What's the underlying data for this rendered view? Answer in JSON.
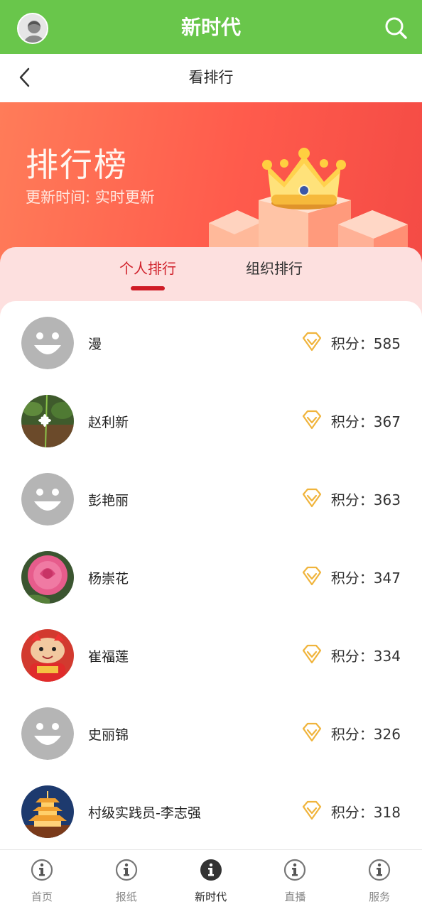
{
  "appbar": {
    "title": "新时代",
    "avatar_icon": "user-avatar-icon",
    "search_icon": "search-icon"
  },
  "subheader": {
    "title": "看排行",
    "back_icon": "chevron-left-icon"
  },
  "banner": {
    "title": "排行榜",
    "subtitle": "更新时间: 实时更新",
    "art_icon": "crown-icon"
  },
  "tabs": [
    {
      "label": "个人排行",
      "active": true
    },
    {
      "label": "组织排行",
      "active": false
    }
  ],
  "rankings": [
    {
      "name": "漫",
      "score_label": "积分：585",
      "avatar": "default-smiley"
    },
    {
      "name": "赵利新",
      "score_label": "积分：367",
      "avatar": "photo-plant"
    },
    {
      "name": "彭艳丽",
      "score_label": "积分：363",
      "avatar": "default-smiley"
    },
    {
      "name": "杨崇花",
      "score_label": "积分：347",
      "avatar": "photo-rose"
    },
    {
      "name": "崔福莲",
      "score_label": "积分：334",
      "avatar": "photo-red-toy"
    },
    {
      "name": "史丽锦",
      "score_label": "积分：326",
      "avatar": "default-smiley"
    },
    {
      "name": "村级实践员-李志强",
      "score_label": "积分：318",
      "avatar": "photo-pagoda"
    }
  ],
  "bottom_nav": [
    {
      "label": "首页",
      "active": false
    },
    {
      "label": "报纸",
      "active": false
    },
    {
      "label": "新时代",
      "active": true
    },
    {
      "label": "直播",
      "active": false
    },
    {
      "label": "服务",
      "active": false
    }
  ],
  "colors": {
    "appbar": "#69c64b",
    "accent_red": "#cf1b25",
    "banner": "#ff6550",
    "diamond": "#f0b43c"
  }
}
